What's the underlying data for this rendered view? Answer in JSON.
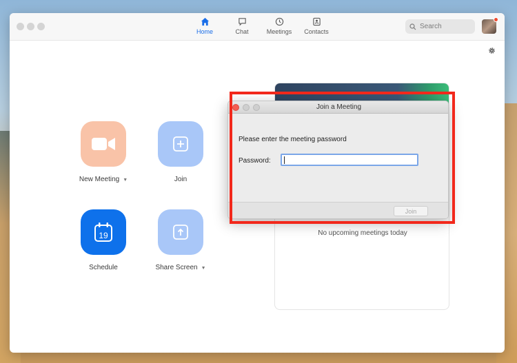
{
  "tabs": [
    {
      "label": "Home",
      "active": true,
      "icon": "home-icon"
    },
    {
      "label": "Chat",
      "active": false,
      "icon": "chat-icon"
    },
    {
      "label": "Meetings",
      "active": false,
      "icon": "clock-icon"
    },
    {
      "label": "Contacts",
      "active": false,
      "icon": "contacts-icon"
    }
  ],
  "search": {
    "placeholder": "Search"
  },
  "actions": {
    "new_meeting": {
      "label": "New Meeting",
      "icon": "video-camera-icon"
    },
    "join": {
      "label": "Join",
      "icon": "plus-icon"
    },
    "schedule": {
      "label": "Schedule",
      "icon": "calendar-icon",
      "day": "19"
    },
    "share_screen": {
      "label": "Share Screen",
      "icon": "upload-arrow-icon"
    }
  },
  "upcoming": {
    "empty_text": "No upcoming meetings today"
  },
  "dialog": {
    "title": "Join a Meeting",
    "prompt": "Please enter the meeting password",
    "password_label": "Password:",
    "password_value": "",
    "join_button": "Join"
  },
  "colors": {
    "accent": "#1a6ee8",
    "new_meeting_tile": "#f9c3a8",
    "join_tile": "#a9c7f8",
    "schedule_tile": "#0e71eb",
    "highlight": "#f2281b"
  }
}
